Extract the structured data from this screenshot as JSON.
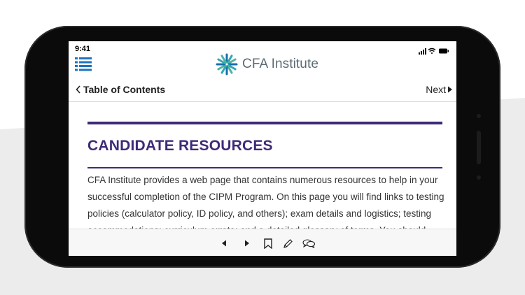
{
  "status_bar": {
    "time": "9:41"
  },
  "header": {
    "brand": "CFA Institute"
  },
  "nav": {
    "back_label": "Table of Contents",
    "next_label": "Next"
  },
  "content": {
    "heading": "CANDIDATE RESOURCES",
    "paragraph": "CFA Institute provides a web page that contains numerous resources to help in your successful completion of the CIPM Program. On this page you will find links to testing policies (calculator policy, ID policy, and others); exam details and logistics; testing accommodations; curriculum errata; and a detailed glossary of terms. You should"
  },
  "colors": {
    "accent": "#3f2a78",
    "brand_blue": "#1e73be",
    "logo_teal": "#2fa8b8"
  },
  "icons": {
    "menu": "list-icon",
    "back": "chevron-left-icon",
    "next": "caret-right-icon",
    "prev_page": "triangle-left-icon",
    "next_page": "triangle-right-icon",
    "bookmark": "bookmark-icon",
    "highlight": "pencil-icon",
    "notes": "chat-bubbles-icon"
  }
}
